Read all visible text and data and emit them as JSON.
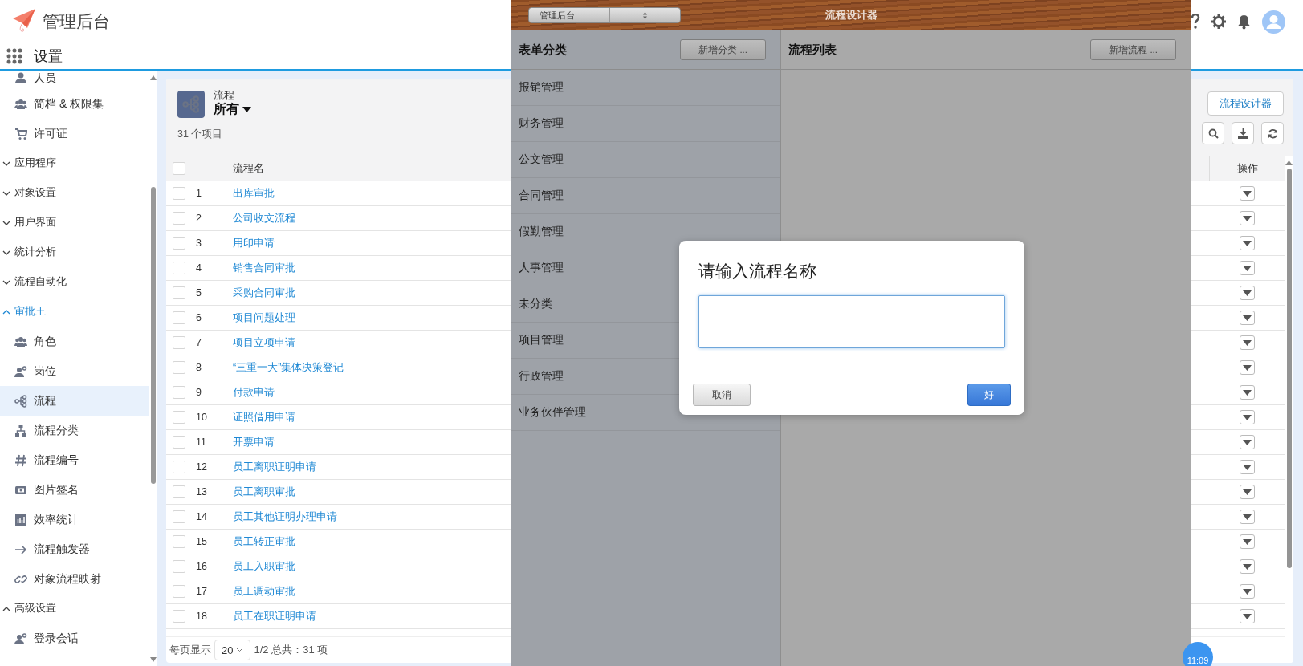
{
  "header": {
    "app_title": "管理后台",
    "section_title": "设置"
  },
  "sidebar": {
    "items": [
      {
        "kind": "item",
        "label": "人员",
        "selected": false
      },
      {
        "kind": "item",
        "label": "简档 & 权限集",
        "selected": false
      },
      {
        "kind": "item",
        "label": "许可证",
        "selected": false
      },
      {
        "kind": "section",
        "label": "应用程序",
        "expanded": false
      },
      {
        "kind": "section",
        "label": "对象设置",
        "expanded": false
      },
      {
        "kind": "section",
        "label": "用户界面",
        "expanded": false
      },
      {
        "kind": "section",
        "label": "统计分析",
        "expanded": false
      },
      {
        "kind": "section",
        "label": "流程自动化",
        "expanded": false
      },
      {
        "kind": "section",
        "label": "审批王",
        "expanded": true,
        "children": [
          {
            "kind": "item",
            "label": "角色",
            "selected": false
          },
          {
            "kind": "item",
            "label": "岗位",
            "selected": false
          },
          {
            "kind": "item",
            "label": "流程",
            "selected": true
          },
          {
            "kind": "item",
            "label": "流程分类",
            "selected": false
          },
          {
            "kind": "item",
            "label": "流程编号",
            "selected": false
          },
          {
            "kind": "item",
            "label": "图片签名",
            "selected": false
          },
          {
            "kind": "item",
            "label": "效率统计",
            "selected": false
          },
          {
            "kind": "item",
            "label": "流程触发器",
            "selected": false
          },
          {
            "kind": "item",
            "label": "对象流程映射",
            "selected": false
          }
        ]
      },
      {
        "kind": "section",
        "label": "高级设置",
        "expanded": true,
        "children": [
          {
            "kind": "item",
            "label": "登录会话",
            "selected": false
          }
        ]
      }
    ]
  },
  "list_view": {
    "object_label": "流程",
    "view_name": "所有",
    "item_count": "31 个项目",
    "designer_button": "流程设计器",
    "all_checked": false,
    "columns": [
      "流程名",
      "操作"
    ],
    "rows": [
      {
        "number": "1",
        "name": "出库审批",
        "checked": false
      },
      {
        "number": "2",
        "name": "公司收文流程",
        "checked": false
      },
      {
        "number": "3",
        "name": "用印申请",
        "checked": false
      },
      {
        "number": "4",
        "name": "销售合同审批",
        "checked": false
      },
      {
        "number": "5",
        "name": "采购合同审批",
        "checked": false
      },
      {
        "number": "6",
        "name": "项目问题处理",
        "checked": false
      },
      {
        "number": "7",
        "name": "项目立项申请",
        "checked": false
      },
      {
        "number": "8",
        "name": "“三重一大”集体决策登记",
        "checked": false
      },
      {
        "number": "9",
        "name": "付款申请",
        "checked": false
      },
      {
        "number": "10",
        "name": "证照借用申请",
        "checked": false
      },
      {
        "number": "11",
        "name": "开票申请",
        "checked": false
      },
      {
        "number": "12",
        "name": "员工离职证明申请",
        "checked": false
      },
      {
        "number": "13",
        "name": "员工离职审批",
        "checked": false
      },
      {
        "number": "14",
        "name": "员工其他证明办理申请",
        "checked": false
      },
      {
        "number": "15",
        "name": "员工转正审批",
        "checked": false
      },
      {
        "number": "16",
        "name": "员工入职审批",
        "checked": false
      },
      {
        "number": "17",
        "name": "员工调动审批",
        "checked": false
      },
      {
        "number": "18",
        "name": "员工在职证明申请",
        "checked": false
      }
    ],
    "pagination": {
      "label": "每页显示",
      "page_size": "20",
      "summary": "1/2 总共：31 项"
    }
  },
  "designer": {
    "title": "流程设计器",
    "app_select": "管理后台",
    "categories_title": "表单分类",
    "add_category": "新增分类 ...",
    "flows_title": "流程列表",
    "add_flow": "新增流程 ...",
    "categories": [
      "报销管理",
      "财务管理",
      "公文管理",
      "合同管理",
      "假勤管理",
      "人事管理",
      "未分类",
      "项目管理",
      "行政管理",
      "业务伙伴管理"
    ]
  },
  "dialog": {
    "title": "请输入流程名称",
    "cancel": "取消",
    "ok": "好"
  },
  "time_badge": "11:09"
}
